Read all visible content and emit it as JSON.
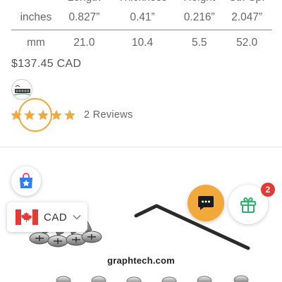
{
  "spec_table": {
    "headers": [
      "",
      "Length",
      "Thickness",
      "Height",
      "Str. Sp."
    ],
    "rows": [
      {
        "unit": "inches",
        "values": [
          "0.827”",
          "0.41”",
          "0.216”",
          "2.047”"
        ]
      },
      {
        "unit": "mm",
        "values": [
          "21.0",
          "10.4",
          "5.5",
          "52.0"
        ]
      }
    ]
  },
  "price": "$137.45 CAD",
  "rating": {
    "stars": 5,
    "filled": 5,
    "reviews_label": "2 Reviews",
    "star_color": "#f2a93b"
  },
  "currency_selector": {
    "code": "CAD",
    "flag_icon": "canada-flag-icon"
  },
  "gift": {
    "badge_count": "2",
    "accent": "#2fb36b"
  },
  "chat": {
    "icon": "chat-bubble-icon",
    "color": "#f2a93b"
  },
  "shop_icon": "shopping-bag-icon",
  "watermark": "graphtech.com"
}
